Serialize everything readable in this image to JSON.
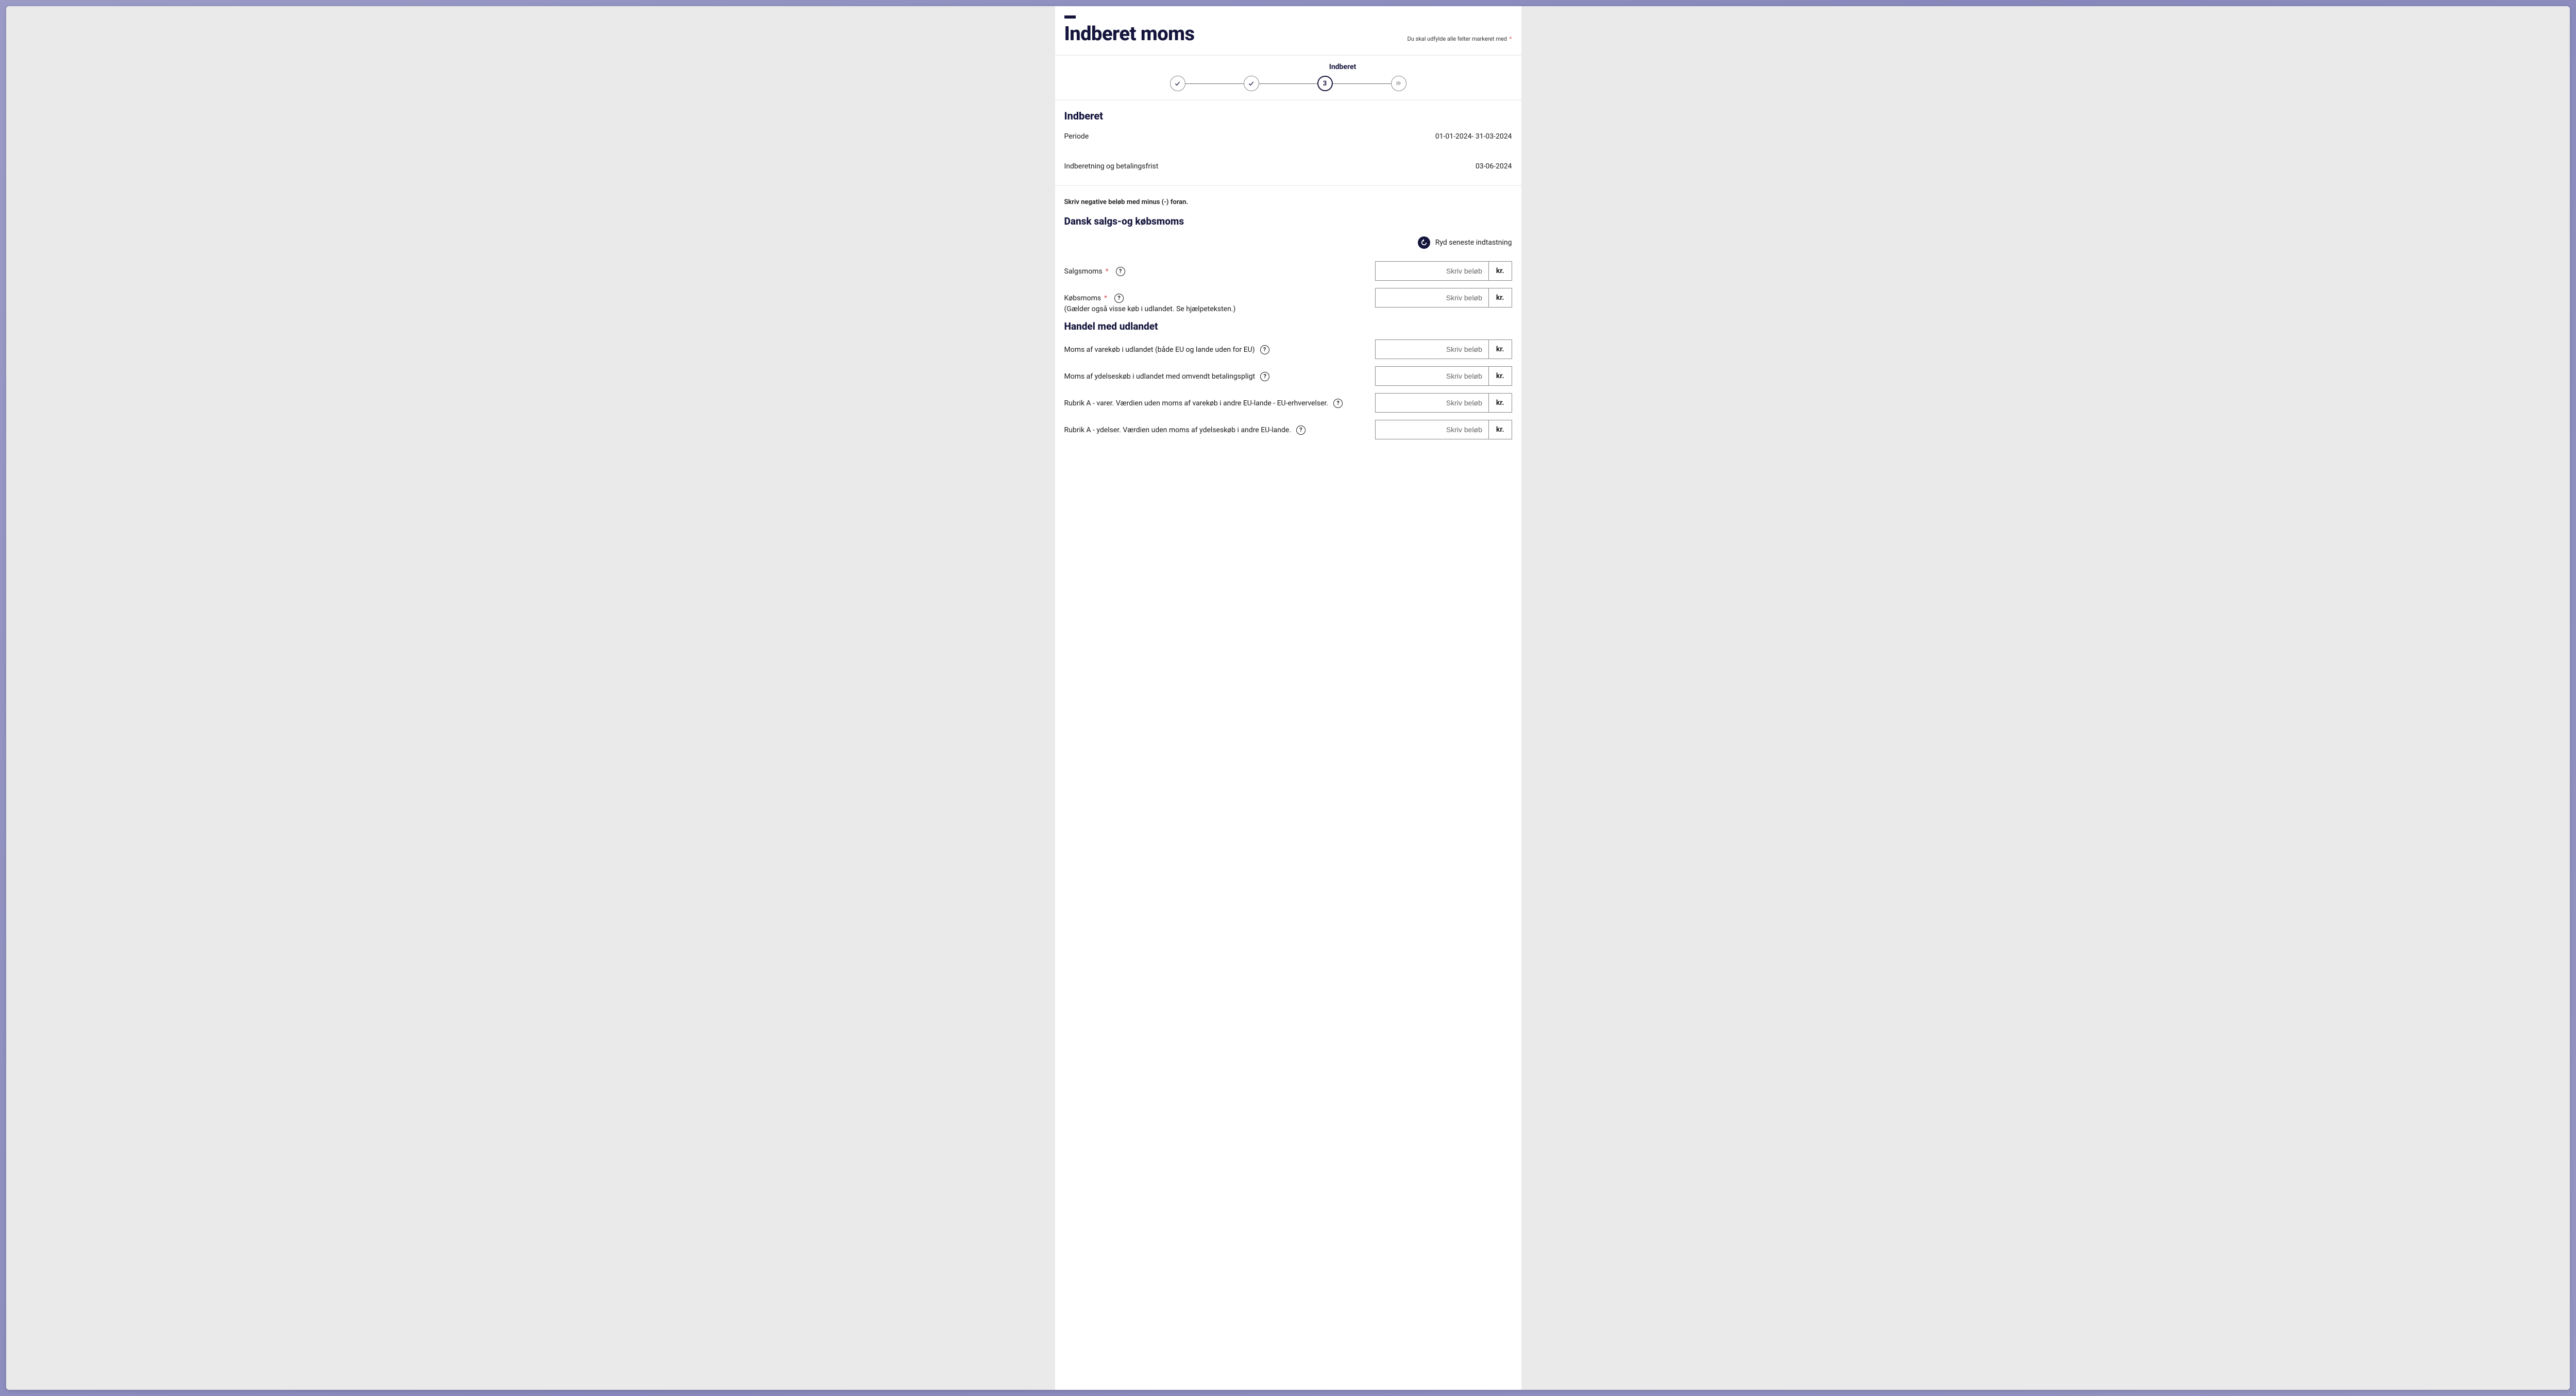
{
  "header": {
    "title": "Indberet moms",
    "required_note": "Du skal udfylde alle felter markeret med",
    "asterisk": "*"
  },
  "stepper": {
    "active_label": "Indberet",
    "current_number": "3"
  },
  "info": {
    "section_title": "Indberet",
    "period_label": "Periode",
    "period_value": "01-01-2024- 31-03-2024",
    "deadline_label": "Indberetning og betalingsfrist",
    "deadline_value": "03-06-2024"
  },
  "form": {
    "hint": "Skriv negative beløb med minus (-) foran.",
    "section1_title": "Dansk salgs-og købsmoms",
    "reset_label": "Ryd seneste indtastning",
    "placeholder": "Skriv beløb",
    "currency": "kr.",
    "help_symbol": "?",
    "salgsmoms_label": "Salgsmoms",
    "kobsmoms_label": "Købsmoms",
    "kobsmoms_sublabel": "(Gælder også visse køb i udlandet. Se hjælpeteksten.)",
    "section2_title": "Handel med udlandet",
    "row3_label": "Moms af varekøb i udlandet (både EU og lande uden for EU)",
    "row4_label": "Moms af ydelseskøb i udlandet med omvendt betalingspligt",
    "row5_label": "Rubrik A - varer. Værdien uden moms af varekøb i andre EU-lande - EU-erhvervelser.",
    "row6_label": "Rubrik A - ydelser. Værdien uden moms af ydelseskøb i andre EU-lande."
  }
}
